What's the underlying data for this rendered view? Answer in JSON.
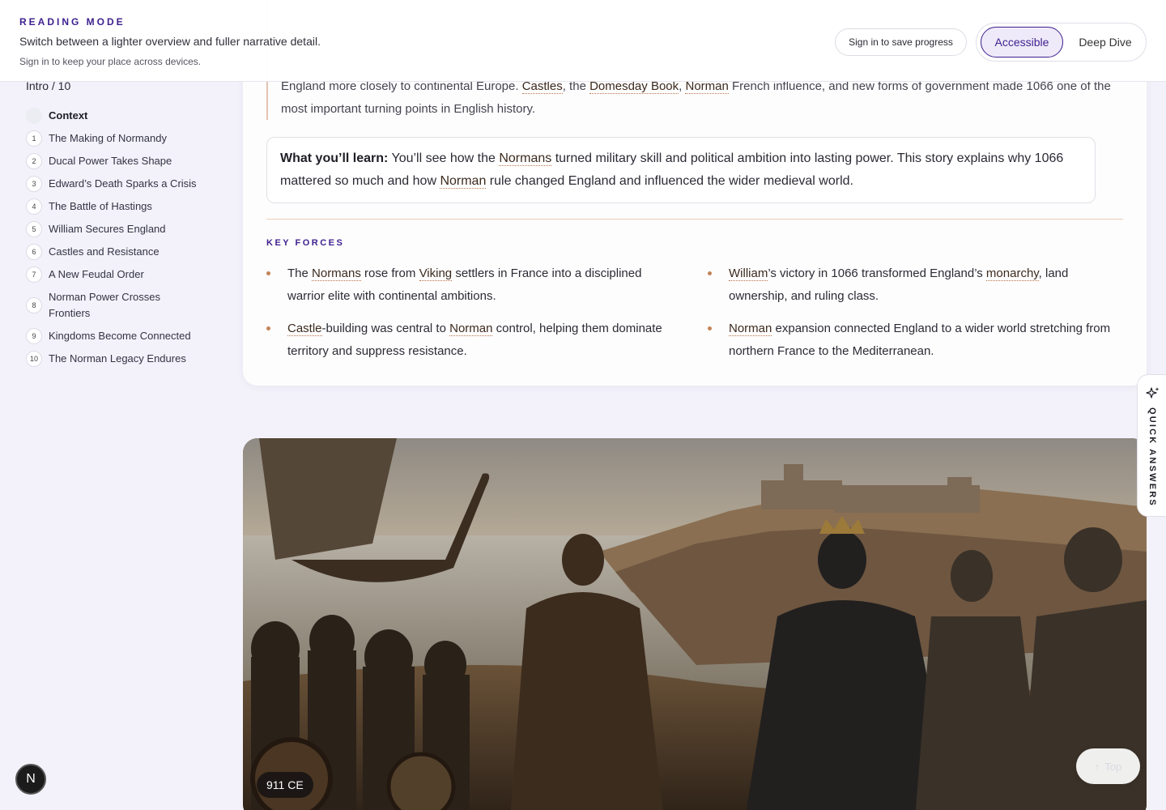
{
  "header": {
    "eyebrow": "READING MODE",
    "description": "Switch between a lighter overview and fuller narrative detail.",
    "note": "Sign in to keep your place across devices.",
    "sign_in_label": "Sign in to save progress",
    "modes": {
      "accessible": "Accessible",
      "deep_dive": "Deep Dive",
      "selected": "Accessible"
    }
  },
  "sidebar": {
    "progress": "Intro / 10",
    "items": [
      {
        "num": "",
        "label": "Context"
      },
      {
        "num": "1",
        "label": "The Making of Normandy"
      },
      {
        "num": "2",
        "label": "Ducal Power Takes Shape"
      },
      {
        "num": "3",
        "label": "Edward’s Death Sparks a Crisis"
      },
      {
        "num": "4",
        "label": "The Battle of Hastings"
      },
      {
        "num": "5",
        "label": "William Secures England"
      },
      {
        "num": "6",
        "label": "Castles and Resistance"
      },
      {
        "num": "7",
        "label": "A New Feudal Order"
      },
      {
        "num": "8",
        "label": "Norman Power Crosses Frontiers"
      },
      {
        "num": "9",
        "label": "Kingdoms Become Connected"
      },
      {
        "num": "10",
        "label": "The Norman Legacy Endures"
      }
    ]
  },
  "intro": {
    "t1": "England more closely to continental Europe. ",
    "castles": "Castles",
    "t2": ", the ",
    "domesday": "Domesday Book",
    "t3": ", ",
    "norman": "Norman",
    "t4": " French influence, and new forms of government made 1066 one of the most important turning points in English history."
  },
  "learn": {
    "lead": "What you’ll learn:",
    "t1": " You’ll see how the ",
    "normans": "Normans",
    "t2": " turned military skill and political ambition into lasting power. This story explains why 1066 mattered so much and how ",
    "norman": "Norman",
    "t3": " rule changed England and influenced the wider medieval world."
  },
  "key_forces": {
    "title": "KEY FORCES",
    "f1": {
      "a": "The ",
      "normans": "Normans",
      "b": " rose from ",
      "viking": "Viking",
      "c": " settlers in France into a disciplined warrior elite with continental ambitions."
    },
    "f2": {
      "william": "William",
      "a": "’s victory in 1066 transformed England’s ",
      "monarchy": "monarchy",
      "b": ", land ownership, and ruling class."
    },
    "f3": {
      "castle": "Castle",
      "a": "-building was central to ",
      "norman": "Norman",
      "b": " control, helping them dominate territory and suppress resistance."
    },
    "f4": {
      "norman": "Norman",
      "a": " expansion connected England to a wider world stretching from northern France to the Mediterranean."
    }
  },
  "quick_answers": {
    "label": "QUICK ANSWERS",
    "icon": "sparkle-icon"
  },
  "hero": {
    "date_badge": "911 CE"
  },
  "top_button": {
    "label": "Top",
    "icon": "arrow-up-icon"
  },
  "avatar": {
    "letter": "N"
  },
  "colors": {
    "accent": "#3d1f8f",
    "term_underline": "#b8744a",
    "bullet": "#c38458",
    "page_bg": "#f3f2fa"
  }
}
